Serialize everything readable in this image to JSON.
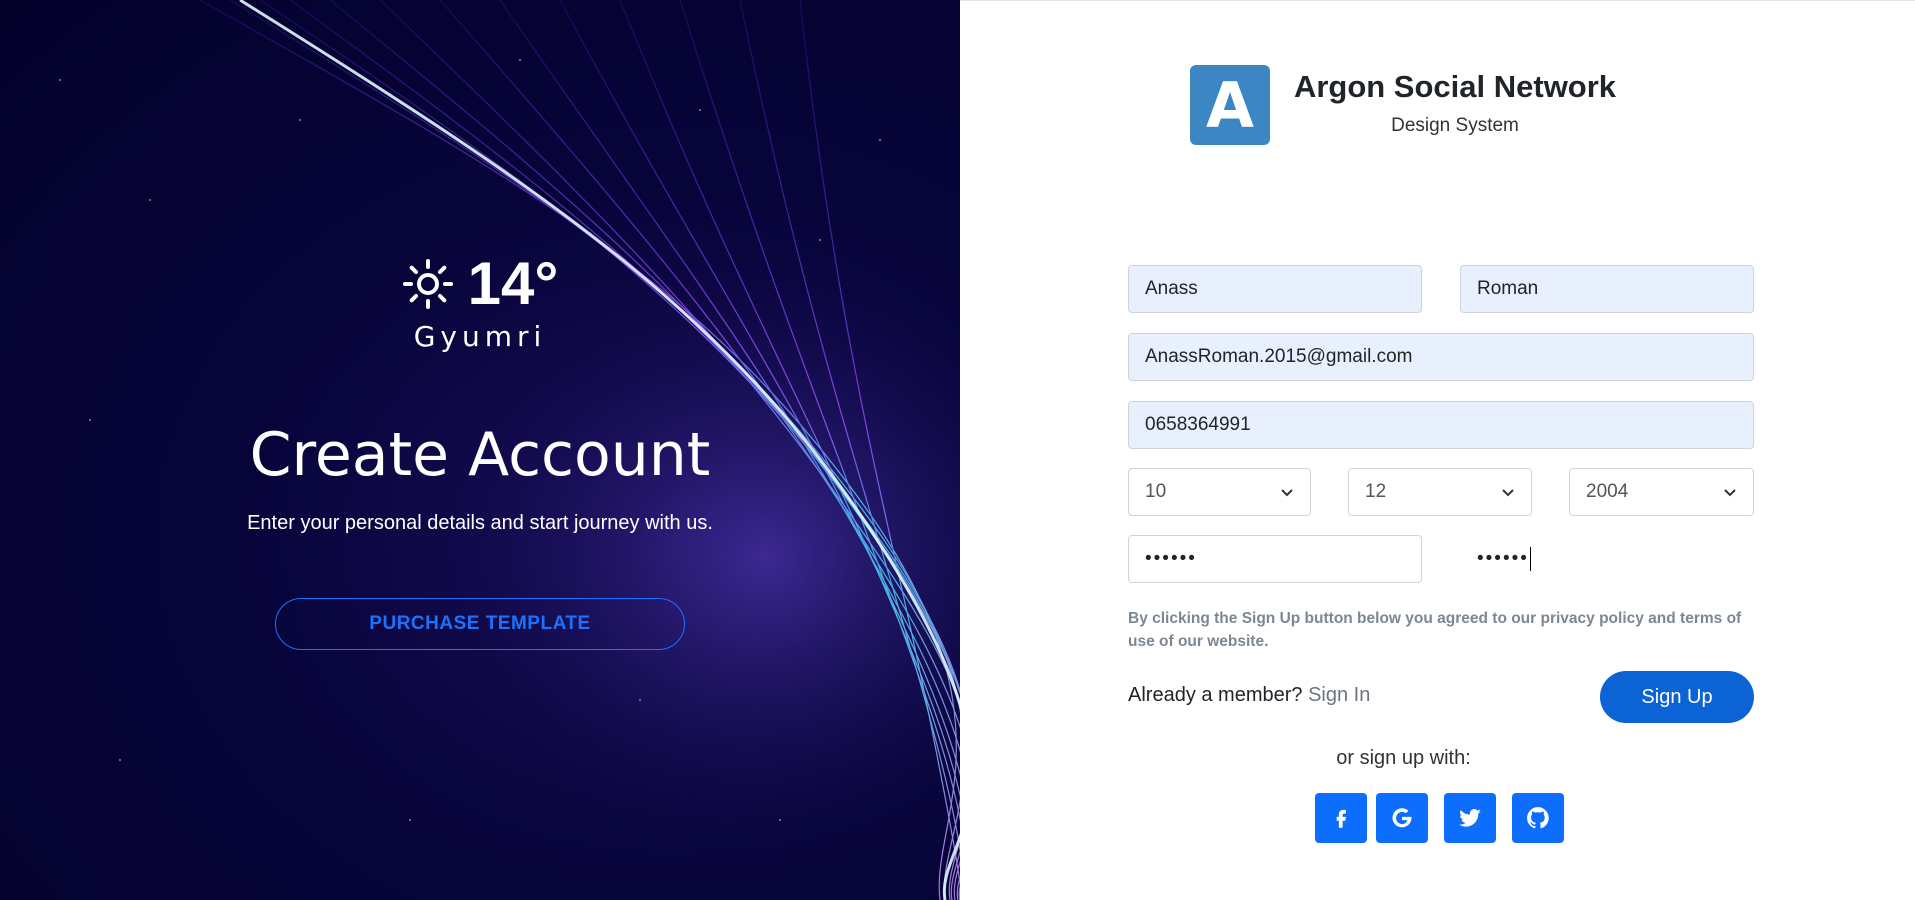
{
  "hero": {
    "weather": {
      "temperature": "14°",
      "city": "Gyumri",
      "icon": "sun-icon"
    },
    "title": "Create Account",
    "subtitle": "Enter your personal details and start journey with us.",
    "purchase_label": "PURCHASE TEMPLATE"
  },
  "brand": {
    "logo_letter": "A",
    "name": "Argon Social Network",
    "tagline": "Design System"
  },
  "form": {
    "first_name": "Anass",
    "last_name": "Roman",
    "email": "AnassRoman.2015@gmail.com",
    "phone": "0658364991",
    "birth_day": "10",
    "birth_month": "12",
    "birth_year": "2004",
    "password": "••••••",
    "password_confirm": "••••••",
    "terms": "By clicking the Sign Up button below you agreed to our privacy policy and terms of use of our website.",
    "member_prompt": "Already a member?",
    "sign_in_link": "Sign In",
    "sign_up_label": "Sign Up",
    "alt_signup": "or sign up with:"
  },
  "social": [
    "facebook-icon",
    "google-icon",
    "twitter-icon",
    "github-icon"
  ],
  "colors": {
    "accent": "#0b63d6",
    "hero_bg": "#07043a",
    "logo_bg": "#3c86c4",
    "autofill_bg": "#e8f0fe"
  }
}
